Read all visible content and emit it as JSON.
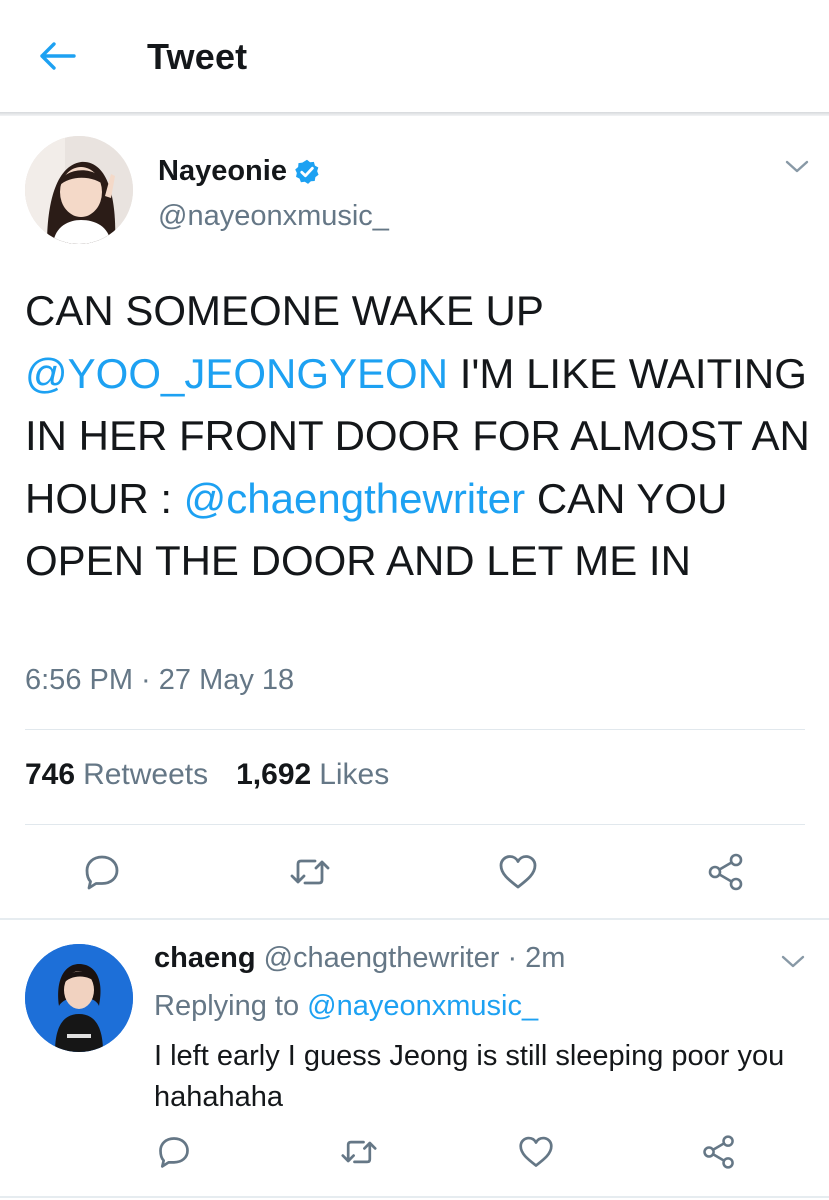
{
  "header": {
    "title": "Tweet",
    "back_icon": "back-arrow-icon"
  },
  "tweet": {
    "author_name": "Nayeonie",
    "author_handle": "@nayeonxmusic_",
    "verified": true,
    "text_parts": [
      {
        "text": "CAN SOMEONE WAKE UP ",
        "mention": false
      },
      {
        "text": "@YOO_JEONGYEON",
        "mention": true
      },
      {
        "text": " I'M LIKE WAITING IN HER FRONT DOOR FOR ALMOST AN HOUR : ",
        "mention": false
      },
      {
        "text": "@chaengthewriter",
        "mention": true
      },
      {
        "text": " CAN YOU OPEN THE DOOR AND LET ME IN",
        "mention": false
      }
    ],
    "timestamp": "6:56 PM · 27 May 18",
    "retweets_count": "746",
    "retweets_label": "Retweets",
    "likes_count": "1,692",
    "likes_label": "Likes"
  },
  "reply": {
    "author_name": "chaeng",
    "author_handle": "@chaengthewriter",
    "time": "· 2m",
    "replying_prefix": "Replying to",
    "replying_to": "@nayeonxmusic_",
    "text": "I left early I guess Jeong is still sleeping poor you hahahaha"
  },
  "colors": {
    "accent": "#1da1f2",
    "text": "#14171a",
    "muted": "#657786",
    "divider": "#e1e8ed"
  },
  "icons": [
    "back-arrow-icon",
    "verified-badge-icon",
    "chevron-down-icon",
    "reply-icon",
    "retweet-icon",
    "like-icon",
    "share-icon"
  ]
}
